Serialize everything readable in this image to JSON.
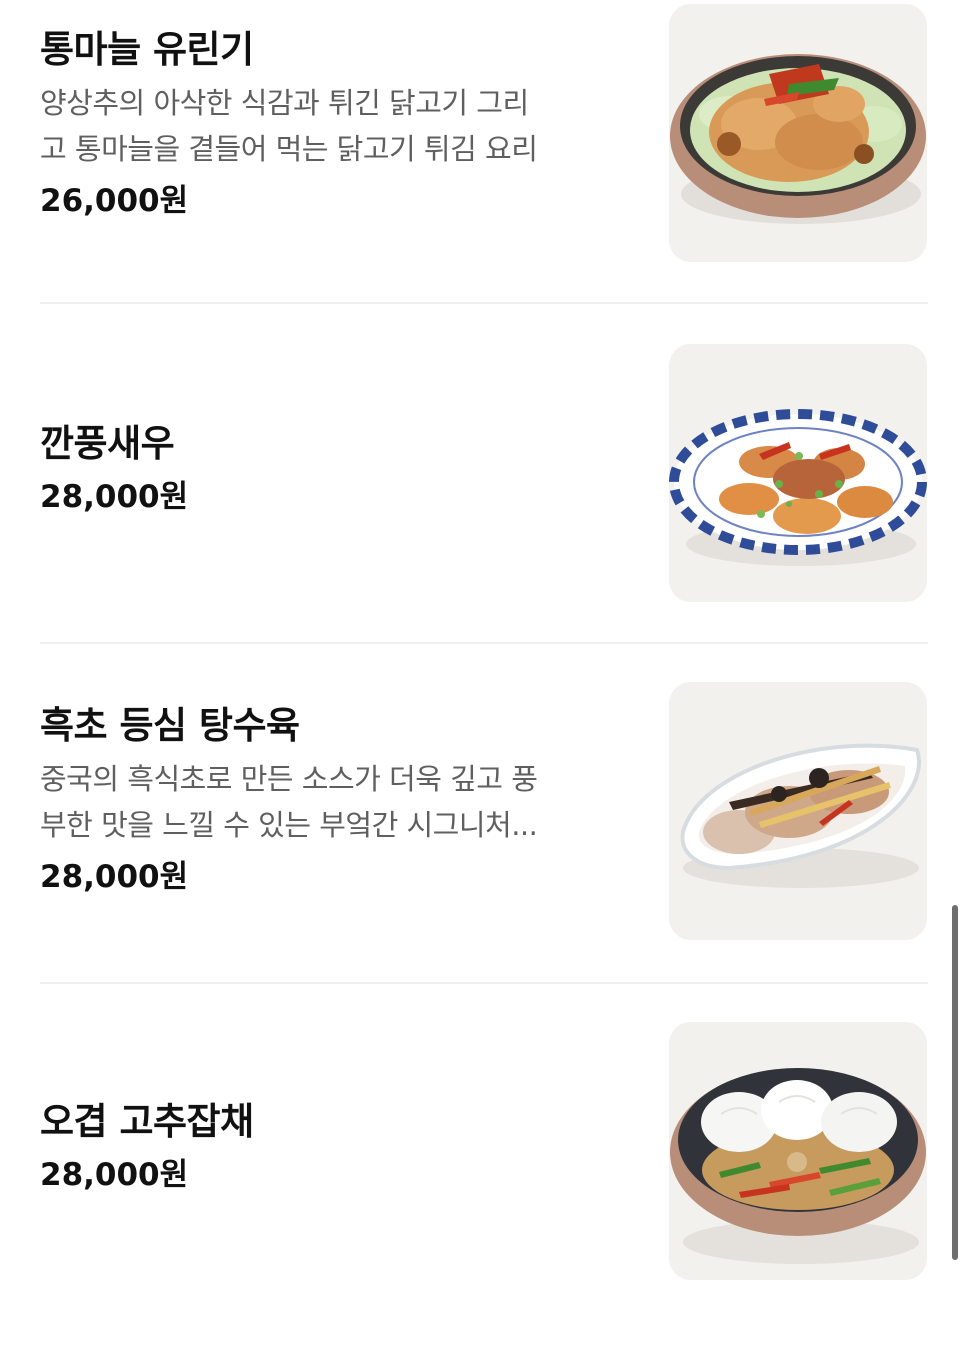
{
  "menu": {
    "items": [
      {
        "name": "통마늘 유린기",
        "description_lines": [
          "양상추의 아삭한 식감과 튀긴 닭고기 그리",
          "고 통마늘을 곁들어 먹는 닭고기 튀김 요리"
        ],
        "price": "26,000원",
        "image_icon": "yurinji-dish-image"
      },
      {
        "name": "깐풍새우",
        "description_lines": [],
        "price": "28,000원",
        "image_icon": "kkanpung-shrimp-dish-image"
      },
      {
        "name": "흑초 등심 탕수육",
        "description_lines": [
          "중국의 흑식초로 만든 소스가 더욱 깊고 풍",
          "부한 맛을 느낄 수 있는 부엌간 시그니처..."
        ],
        "price": "28,000원",
        "image_icon": "black-vinegar-tangsuyuk-dish-image"
      },
      {
        "name": "오겹 고추잡채",
        "description_lines": [],
        "price": "28,000원",
        "image_icon": "pepper-japchae-dish-image"
      }
    ]
  },
  "colors": {
    "text_primary": "#111111",
    "text_secondary": "#5f5f5f",
    "divider": "#f0f0f0",
    "image_bg": "#f1f1ef",
    "scrollbar": "#6e6e6e"
  }
}
